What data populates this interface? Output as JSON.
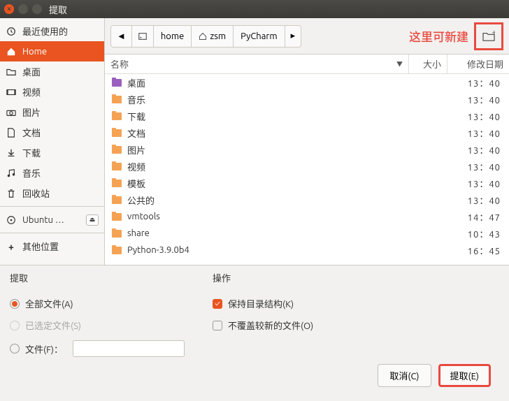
{
  "window": {
    "title": "提取"
  },
  "toolbar": {
    "breadcrumb": [
      "home",
      "zsm",
      "PyCharm"
    ],
    "annotation": "这里可新建"
  },
  "sidebar": {
    "items": [
      {
        "icon": "clock",
        "label": "最近使用的"
      },
      {
        "icon": "home",
        "label": "Home",
        "selected": true
      },
      {
        "icon": "folder",
        "label": "桌面"
      },
      {
        "icon": "video",
        "label": "视频"
      },
      {
        "icon": "camera",
        "label": "图片"
      },
      {
        "icon": "doc",
        "label": "文档"
      },
      {
        "icon": "download",
        "label": "下载"
      },
      {
        "icon": "music",
        "label": "音乐"
      },
      {
        "icon": "trash",
        "label": "回收站"
      }
    ],
    "devices": [
      {
        "icon": "disc",
        "label": "Ubuntu …",
        "eject": true
      }
    ],
    "other": [
      {
        "icon": "plus",
        "label": "其他位置"
      }
    ]
  },
  "list": {
    "headers": {
      "name": "名称",
      "size": "大小",
      "date": "修改日期"
    },
    "rows": [
      {
        "name": "桌面",
        "date": "13：40",
        "color": "purple"
      },
      {
        "name": "音乐",
        "date": "13：40",
        "color": "orange"
      },
      {
        "name": "下载",
        "date": "13：40",
        "color": "orange"
      },
      {
        "name": "文档",
        "date": "13：40",
        "color": "orange"
      },
      {
        "name": "图片",
        "date": "13：40",
        "color": "orange"
      },
      {
        "name": "视频",
        "date": "13：40",
        "color": "orange"
      },
      {
        "name": "模板",
        "date": "13：40",
        "color": "orange"
      },
      {
        "name": "公共的",
        "date": "13：40",
        "color": "orange"
      },
      {
        "name": "vmtools",
        "date": "14：47",
        "color": "orange"
      },
      {
        "name": "share",
        "date": "10：43",
        "color": "orange"
      },
      {
        "name": "Python-3.9.0b4",
        "date": "16：45",
        "color": "orange"
      }
    ]
  },
  "options": {
    "extract_heading": "提取",
    "operations_heading": "操作",
    "all_files": "全部文件(A)",
    "selected_files": "已选定文件(S)",
    "files": "文件(F)：",
    "keep_structure": "保持目录结构(K)",
    "no_overwrite": "不覆盖较新的文件(O)"
  },
  "footer": {
    "cancel": "取消(C)",
    "extract": "提取(E)"
  }
}
